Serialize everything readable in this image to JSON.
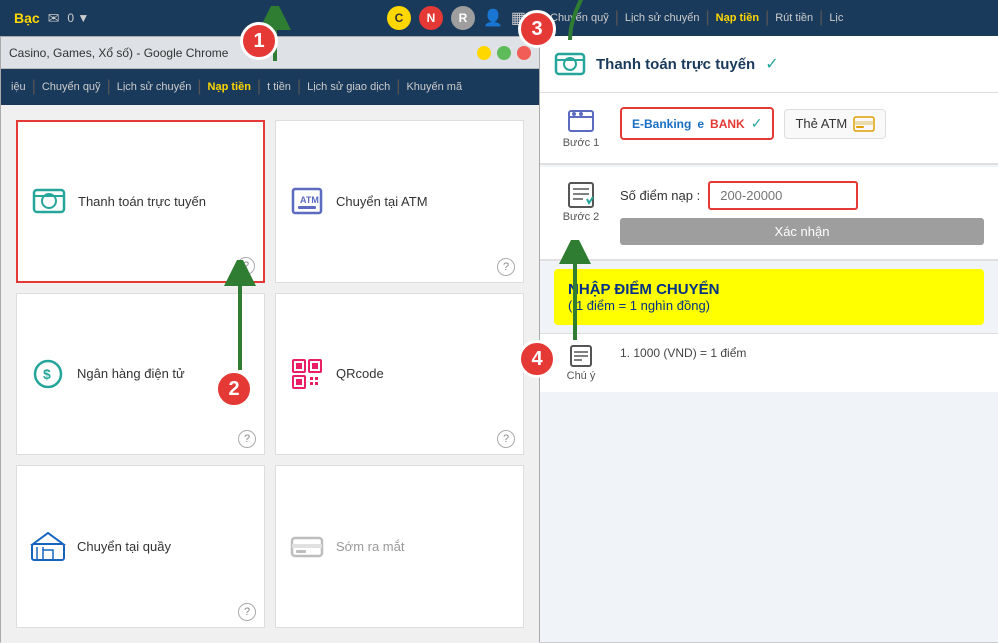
{
  "topbar": {
    "username": "Bạc",
    "msg_icon": "✉",
    "msg_count": "0",
    "icon_c": "C",
    "icon_n": "N",
    "icon_r": "R"
  },
  "chrome": {
    "title": "Casino, Games, Xổ số) - Google Chrome",
    "min": "—",
    "max": "□",
    "close": "✕"
  },
  "left_nav": {
    "items": [
      {
        "label": "iệu",
        "active": false
      },
      {
        "label": "Chuyển quỹ",
        "active": false
      },
      {
        "label": "Lịch sử chuyển",
        "active": false
      },
      {
        "label": "Nạp tiền",
        "active": true
      },
      {
        "label": "t tiền",
        "active": false
      },
      {
        "label": "Lịch sử giao dịch",
        "active": false
      },
      {
        "label": "Khuyến mã",
        "active": false
      }
    ]
  },
  "payment_options": [
    {
      "id": "online",
      "label": "Thanh toán trực tuyến",
      "icon": "💳",
      "selected": true
    },
    {
      "id": "atm",
      "label": "Chuyển tại ATM",
      "icon": "🏧",
      "selected": false
    },
    {
      "id": "ebank",
      "label": "Ngân hàng điện tử",
      "icon": "💲",
      "selected": false
    },
    {
      "id": "qr",
      "label": "QRcode",
      "icon": "▦",
      "selected": false
    },
    {
      "id": "counter",
      "label": "Chuyển tại quầy",
      "icon": "🏦",
      "selected": false
    },
    {
      "id": "newcard",
      "label": "Sớm ra mắt",
      "icon": "💳",
      "selected": false
    }
  ],
  "right_nav": {
    "items": [
      {
        "label": "Chuyển quỹ",
        "active": false
      },
      {
        "label": "Lịch sử chuyển",
        "active": false
      },
      {
        "label": "Nạp tiền",
        "active": true
      },
      {
        "label": "Rút tiền",
        "active": false
      },
      {
        "label": "Lịc",
        "active": false
      }
    ]
  },
  "right_panel": {
    "header": {
      "title": "Thanh toán trực tuyến",
      "verified": "✓"
    },
    "step1": {
      "label": "Bước 1",
      "ebanking_label": "E-Banking",
      "ebank_text": "EBANK",
      "atm_label": "Thẻ ATM",
      "selected": "ebank"
    },
    "step2": {
      "label": "Bước 2",
      "points_label": "Số điểm nạp :",
      "points_placeholder": "200-20000",
      "confirm_label": "Xác nhận"
    },
    "callout": {
      "title": "NHẬP ĐIỂM CHUYỂN",
      "subtitle": "( 1 điểm = 1 nghìn đồng)"
    },
    "note": {
      "label": "Chú ý",
      "content": "1.  1000 (VND) = 1 điểm"
    }
  },
  "steps": {
    "step1_badge": "1",
    "step2_badge": "2",
    "step3_badge": "3",
    "step4_badge": "4"
  }
}
